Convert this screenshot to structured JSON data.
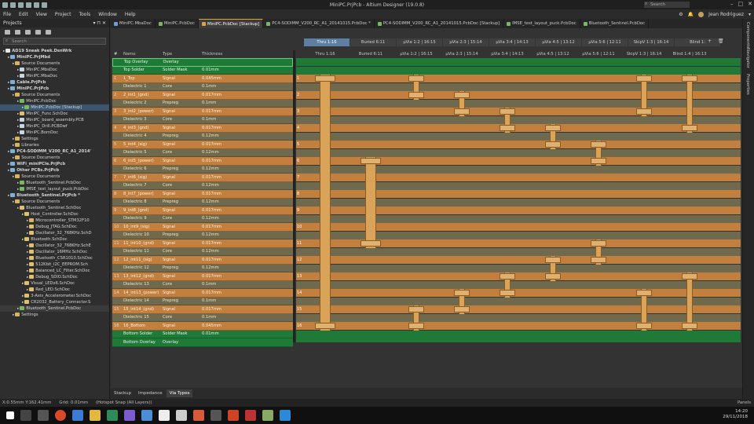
{
  "window": {
    "title": "MiniPC.PrjPcb - Altium Designer (19.0.8)",
    "search_placeholder": "Search",
    "user": "Jean Rodriguez"
  },
  "menu": [
    "File",
    "Edit",
    "View",
    "Project",
    "Tools",
    "Window",
    "Help"
  ],
  "projects_panel": {
    "title": "Projects",
    "search_placeholder": "Search",
    "tree": [
      {
        "label": "AD19 Sneak Peek.DsnWrk",
        "indent": 0,
        "icon": "ws",
        "bold": true
      },
      {
        "label": "MiniPC.PrjMbd",
        "indent": 1,
        "icon": "proj",
        "bold": true
      },
      {
        "label": "Source Documents",
        "indent": 2,
        "icon": "folder"
      },
      {
        "label": "MiniPC.MbsDoc",
        "indent": 3,
        "icon": "doc"
      },
      {
        "label": "MiniPC.MbaDoc",
        "indent": 3,
        "icon": "doc"
      },
      {
        "label": "Cable.PrjPcb",
        "indent": 1,
        "icon": "proj",
        "bold": true
      },
      {
        "label": "MiniPC.PrjPcb",
        "indent": 1,
        "icon": "proj",
        "bold": true
      },
      {
        "label": "Source Documents",
        "indent": 2,
        "icon": "folder"
      },
      {
        "label": "MiniPC.PcbDoc",
        "indent": 3,
        "icon": "pcb"
      },
      {
        "label": "MiniPC.PcbDoc [Stackup]",
        "indent": 4,
        "icon": "pcb",
        "selected": true
      },
      {
        "label": "MiniPC_Func.SchDoc",
        "indent": 3,
        "icon": "sch"
      },
      {
        "label": "MiniPC_board_assembly.PCB",
        "indent": 3,
        "icon": "doc"
      },
      {
        "label": "MiniPC_Drill.PCBDwf",
        "indent": 3,
        "icon": "doc"
      },
      {
        "label": "MiniPC.BomDoc",
        "indent": 3,
        "icon": "doc"
      },
      {
        "label": "Settings",
        "indent": 2,
        "icon": "folder"
      },
      {
        "label": "Libraries",
        "indent": 2,
        "icon": "folder"
      },
      {
        "label": "PC4-SODIMM_V200_RC_A1_2014'",
        "indent": 1,
        "icon": "proj",
        "bold": true
      },
      {
        "label": "Source Documents",
        "indent": 2,
        "icon": "folder"
      },
      {
        "label": "WiFi_miniPCIe.PrjPcb",
        "indent": 1,
        "icon": "proj",
        "bold": true
      },
      {
        "label": "Other PCBs.PrjPcb",
        "indent": 1,
        "icon": "proj",
        "bold": true
      },
      {
        "label": "Source Documents",
        "indent": 2,
        "icon": "folder"
      },
      {
        "label": "Bluetooth_Sentinel.PcbDoc",
        "indent": 3,
        "icon": "pcb"
      },
      {
        "label": "IMSE_test_layout_puck.PcbDoc",
        "indent": 3,
        "icon": "pcb"
      },
      {
        "label": "Bluetooth_Sentinel.PrjPcb *",
        "indent": 1,
        "icon": "proj",
        "bold": true
      },
      {
        "label": "Source Documents",
        "indent": 2,
        "icon": "folder"
      },
      {
        "label": "Bluetooth_Sentinel.SchDoc",
        "indent": 3,
        "icon": "sch"
      },
      {
        "label": "Host_Controller.SchDoc",
        "indent": 4,
        "icon": "sch"
      },
      {
        "label": "Microcontroller_STM32F10",
        "indent": 5,
        "icon": "folder"
      },
      {
        "label": "Debug_JTAG.SchDoc",
        "indent": 5,
        "icon": "sch"
      },
      {
        "label": "Oscillator_32_768KHz.SchD",
        "indent": 5,
        "icon": "sch"
      },
      {
        "label": "Bluetooth.SchDoc",
        "indent": 4,
        "icon": "sch"
      },
      {
        "label": "Oscillator_32_768KHz.SchE",
        "indent": 5,
        "icon": "sch"
      },
      {
        "label": "Oscillator_16MHz.SchDoc",
        "indent": 5,
        "icon": "sch"
      },
      {
        "label": "Bluetooth_CSR1010.SchDoc",
        "indent": 5,
        "icon": "sch"
      },
      {
        "label": "512Kbit_I2C_EEPROM.Sch",
        "indent": 5,
        "icon": "sch"
      },
      {
        "label": "Balanced_LC_Filter.SchDoc",
        "indent": 5,
        "icon": "sch"
      },
      {
        "label": "Debug_SDIO.SchDoc",
        "indent": 5,
        "icon": "sch"
      },
      {
        "label": "Visual_LEDx6.SchDoc",
        "indent": 4,
        "icon": "sch"
      },
      {
        "label": "Red_LED.SchDoc",
        "indent": 5,
        "icon": "sch"
      },
      {
        "label": "3-Axis_Accelerometer.SchDoc",
        "indent": 4,
        "icon": "sch"
      },
      {
        "label": "CR2032_Battery_Connector.S",
        "indent": 4,
        "icon": "sch"
      },
      {
        "label": "Bluetooth_Sentinel.PcbDoc",
        "indent": 3,
        "icon": "pcb",
        "highlight": true
      },
      {
        "label": "Settings",
        "indent": 2,
        "icon": "folder"
      }
    ]
  },
  "doc_tabs": [
    {
      "label": "MiniPC.MbaDoc",
      "color": "#6aa0d8"
    },
    {
      "label": "MiniPC.PcbDoc",
      "color": "#7ab85f"
    },
    {
      "label": "MiniPC.PcbDoc [Stackup]",
      "color": "#d9a340",
      "active": true
    },
    {
      "label": "PC4-SODIMM_V200_RC_A1_20141015.PcbDoc *",
      "color": "#7ab85f"
    },
    {
      "label": "PC4-SODIMM_V200_RC_A1_20141015.PcbDoc [Stackup]",
      "color": "#7ab85f"
    },
    {
      "label": "IMSE_test_layout_puck.PcbDoc",
      "color": "#7ab85f"
    },
    {
      "label": "Bluetooth_Sentinel.PcbDoc",
      "color": "#7ab85f"
    }
  ],
  "right_panels": [
    "Components",
    "Navigator",
    "Properties"
  ],
  "stackup": {
    "headers": {
      "num": "#",
      "name": "Name",
      "type": "Type",
      "thickness": "Thickness"
    },
    "layers": [
      {
        "num": "",
        "name": "Top Overlay",
        "type": "Overlay",
        "thickness": "",
        "kind": "overlay"
      },
      {
        "num": "",
        "name": "Top Solder",
        "type": "Solder Mask",
        "thickness": "0.01mm",
        "kind": "overlay"
      },
      {
        "num": "1",
        "name": "1_Top",
        "type": "Signal",
        "thickness": "0.045mm",
        "kind": "signal"
      },
      {
        "num": "",
        "name": "Dielectric 1",
        "type": "Core",
        "thickness": "0.1mm",
        "kind": "diel"
      },
      {
        "num": "2",
        "name": "2_int1_(gnd)",
        "type": "Signal",
        "thickness": "0.017mm",
        "kind": "signal"
      },
      {
        "num": "",
        "name": "Dielectric 2",
        "type": "Prepreg",
        "thickness": "0.1mm",
        "kind": "diel"
      },
      {
        "num": "3",
        "name": "3_int2_(power)",
        "type": "Signal",
        "thickness": "0.017mm",
        "kind": "signal"
      },
      {
        "num": "",
        "name": "Dielectric 3",
        "type": "Core",
        "thickness": "0.1mm",
        "kind": "diel"
      },
      {
        "num": "4",
        "name": "4_int3_(gnd)",
        "type": "Signal",
        "thickness": "0.017mm",
        "kind": "signal"
      },
      {
        "num": "",
        "name": "Dielectric 4",
        "type": "Prepreg",
        "thickness": "0.12mm",
        "kind": "diel"
      },
      {
        "num": "5",
        "name": "5_int4_(sig)",
        "type": "Signal",
        "thickness": "0.017mm",
        "kind": "signal"
      },
      {
        "num": "",
        "name": "Dielectric 5",
        "type": "Core",
        "thickness": "0.12mm",
        "kind": "diel"
      },
      {
        "num": "6",
        "name": "6_int5_(power)",
        "type": "Signal",
        "thickness": "0.017mm",
        "kind": "signal"
      },
      {
        "num": "",
        "name": "Dielectric 6",
        "type": "Prepreg",
        "thickness": "0.12mm",
        "kind": "diel"
      },
      {
        "num": "7",
        "name": "7_int6_(sig)",
        "type": "Signal",
        "thickness": "0.017mm",
        "kind": "signal"
      },
      {
        "num": "",
        "name": "Dielectric 7",
        "type": "Core",
        "thickness": "0.12mm",
        "kind": "diel"
      },
      {
        "num": "8",
        "name": "8_int7_(power)",
        "type": "Signal",
        "thickness": "0.017mm",
        "kind": "signal"
      },
      {
        "num": "",
        "name": "Dielectric 8",
        "type": "Prepreg",
        "thickness": "0.12mm",
        "kind": "diel"
      },
      {
        "num": "9",
        "name": "9_int8_(gnd)",
        "type": "Signal",
        "thickness": "0.017mm",
        "kind": "signal"
      },
      {
        "num": "",
        "name": "Dielectric 9",
        "type": "Core",
        "thickness": "0.12mm",
        "kind": "diel"
      },
      {
        "num": "10",
        "name": "10_int9_(sig)",
        "type": "Signal",
        "thickness": "0.017mm",
        "kind": "signal"
      },
      {
        "num": "",
        "name": "Dielectric 10",
        "type": "Prepreg",
        "thickness": "0.12mm",
        "kind": "diel"
      },
      {
        "num": "11",
        "name": "11_int10_(gnd)",
        "type": "Signal",
        "thickness": "0.017mm",
        "kind": "signal"
      },
      {
        "num": "",
        "name": "Dielectric 11",
        "type": "Core",
        "thickness": "0.12mm",
        "kind": "diel"
      },
      {
        "num": "12",
        "name": "12_int11_(sig)",
        "type": "Signal",
        "thickness": "0.017mm",
        "kind": "signal"
      },
      {
        "num": "",
        "name": "Dielectric 12",
        "type": "Prepreg",
        "thickness": "0.12mm",
        "kind": "diel"
      },
      {
        "num": "13",
        "name": "13_int12_(gnd)",
        "type": "Signal",
        "thickness": "0.017mm",
        "kind": "signal"
      },
      {
        "num": "",
        "name": "Dielectric 13",
        "type": "Core",
        "thickness": "0.1mm",
        "kind": "diel"
      },
      {
        "num": "14",
        "name": "14_int13_(power)",
        "type": "Signal",
        "thickness": "0.017mm",
        "kind": "signal"
      },
      {
        "num": "",
        "name": "Dielectric 14",
        "type": "Prepreg",
        "thickness": "0.1mm",
        "kind": "diel"
      },
      {
        "num": "15",
        "name": "15_int14_(gnd)",
        "type": "Signal",
        "thickness": "0.017mm",
        "kind": "signal"
      },
      {
        "num": "",
        "name": "Dielectric 15",
        "type": "Core",
        "thickness": "0.1mm",
        "kind": "diel"
      },
      {
        "num": "16",
        "name": "16_Bottom",
        "type": "Signal",
        "thickness": "0.045mm",
        "kind": "signal"
      },
      {
        "num": "",
        "name": "Bottom Solder",
        "type": "Solder Mask",
        "thickness": "0.01mm",
        "kind": "overlay"
      },
      {
        "num": "",
        "name": "Bottom Overlay",
        "type": "Overlay",
        "thickness": "",
        "kind": "overlay"
      }
    ]
  },
  "via_tabs": [
    "Thru 1:16",
    "Buried 6:11",
    "µVia 1:2 | 16:15",
    "µVia 2:3 | 15:14",
    "µVia 3:4 | 14:13",
    "µVia 4:5 | 13:12",
    "µVia 5:6 | 12:11",
    "SkipV 1:3 | 16:14",
    "Blind 1:"
  ],
  "via_columns": [
    "Thru 1:16",
    "Buried 6:11",
    "µVia 1:2 | 16:15",
    "µVia 2:3 | 15:14",
    "µVia 3:4 | 14:13",
    "µVia 4:5 | 13:12",
    "µVia 5:6 | 12:11",
    "SkipV 1:3 | 16:14",
    "Blind 1:4 | 16:13"
  ],
  "bottom_tabs": [
    "Stackup",
    "Impedance",
    "Via Types"
  ],
  "status": {
    "coords": "X:0.55mm Y:162.41mm",
    "grid": "Grid: 0.01mm",
    "snap": "(Hotspot Snap (All Layers))",
    "panels": "Panels"
  },
  "clock": {
    "time": "14:20",
    "date": "29/11/2018"
  },
  "colors": {
    "signal": "#c27f3e",
    "dielectric": "#6f6a4e",
    "overlay": "#1e7a36",
    "via": "#d9a35a"
  }
}
